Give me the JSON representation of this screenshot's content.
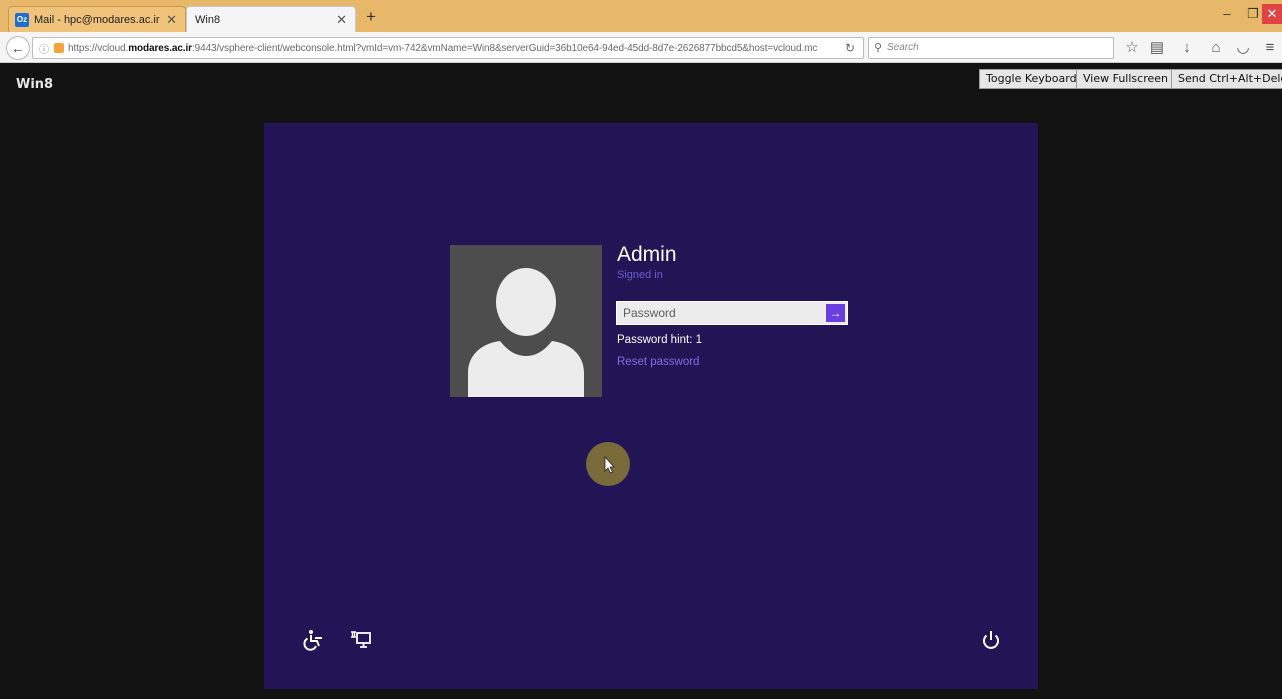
{
  "browser": {
    "tabs": [
      {
        "label": "Mail - hpc@modares.ac.ir",
        "favicon": "Oz"
      },
      {
        "label": "Win8"
      }
    ],
    "url": {
      "prefix": "https://vcloud.",
      "domain": "modares.ac.ir",
      "rest": ":9443/vsphere-client/webconsole.html?vmId=vm-742&vmName=Win8&serverGuid=36b10e64-94ed-45dd-8d7e-2626877bbcd5&host=vcloud.mc"
    },
    "search_placeholder": "Search"
  },
  "console": {
    "vm_name": "Win8",
    "buttons": {
      "toggle_keyboard": "Toggle Keyboard",
      "view_fullscreen": "View Fullscreen",
      "send_cad": "Send Ctrl+Alt+Delete"
    }
  },
  "login": {
    "user_name": "Admin",
    "status": "Signed in",
    "password_placeholder": "Password",
    "password_hint": "Password hint: 1",
    "reset_link": "Reset password"
  },
  "colors": {
    "lock_screen_bg": "#221556",
    "accent": "#6a3fe0",
    "link": "#7e6ee0",
    "tabbar": "#e8b86a"
  }
}
